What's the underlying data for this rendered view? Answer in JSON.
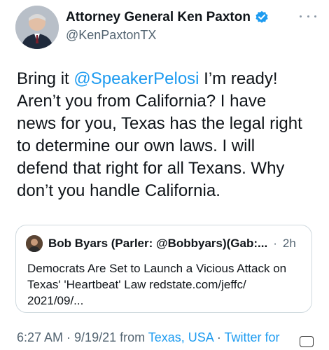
{
  "author": {
    "display_name": "Attorney General Ken Paxton",
    "handle": "@KenPaxtonTX",
    "verified": true
  },
  "tweet": {
    "pre": "Bring it ",
    "mention": "@SpeakerPelosi",
    "post": " I’m ready!\nAren’t you from California? I have\nnews for you, Texas has the legal right\nto determine our own laws. I will\ndefend that right for all Texans. Why\ndon’t you handle California."
  },
  "quote": {
    "name": "Bob Byars (Parler: @Bobbyars)(Gab:...",
    "separator": "·",
    "time": "2h",
    "text": "Democrats Are Set to Launch a Vicious Attack on Texas' 'Heartbeat' Law redstate.com/jeffc/ 2021/09/..."
  },
  "meta": {
    "time": "6:27 AM",
    "sep1": " · ",
    "date": "9/19/21 from ",
    "location": "Texas, USA",
    "sep2": " · ",
    "client": "Twitter for"
  },
  "colors": {
    "accent": "#1d9bf0",
    "secondary_text": "#536471"
  },
  "icons": {
    "verified": "verified-badge-icon",
    "more": "more-options-icon"
  }
}
